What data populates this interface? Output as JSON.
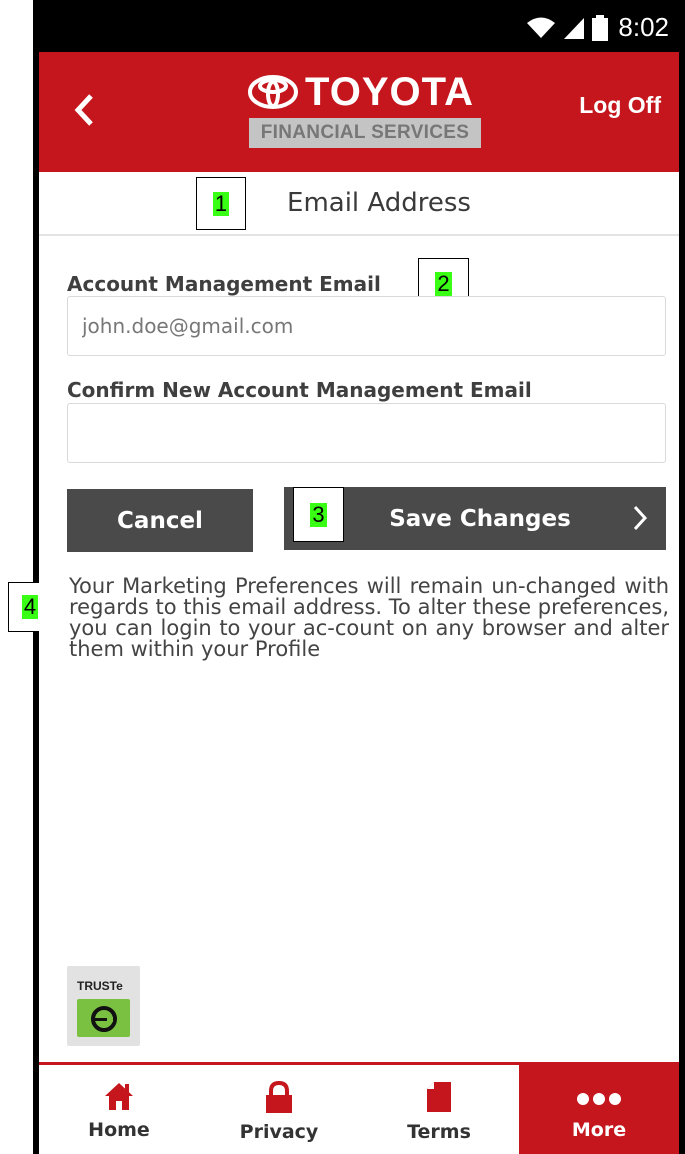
{
  "status_bar": {
    "time": "8:02"
  },
  "header": {
    "logo_text": "TOYOTA",
    "logo_subtext": "FINANCIAL SERVICES",
    "logoff_label": "Log Off"
  },
  "page": {
    "title": "Email Address"
  },
  "form": {
    "email_label": "Account Management Email",
    "email_value": "john.doe@gmail.com",
    "confirm_label": "Confirm New Account Management Email",
    "confirm_value": "",
    "cancel_label": "Cancel",
    "save_label": "Save Changes"
  },
  "note": "Your Marketing Preferences will remain un-changed with regards to this email address. To alter these preferences, you can login to your ac-count on any browser and alter them within your Profile",
  "truste": {
    "label": "TRUSTe"
  },
  "bottom_nav": {
    "items": [
      {
        "label": "Home",
        "icon": "home-icon"
      },
      {
        "label": "Privacy",
        "icon": "lock-icon"
      },
      {
        "label": "Terms",
        "icon": "document-icon"
      },
      {
        "label": "More",
        "icon": "more-dots-icon"
      }
    ]
  },
  "markers": [
    "1",
    "2",
    "3",
    "4"
  ],
  "colors": {
    "brand_red": "#c5161d",
    "button_gray": "#4a4a4a",
    "marker_green": "#39ff14"
  }
}
